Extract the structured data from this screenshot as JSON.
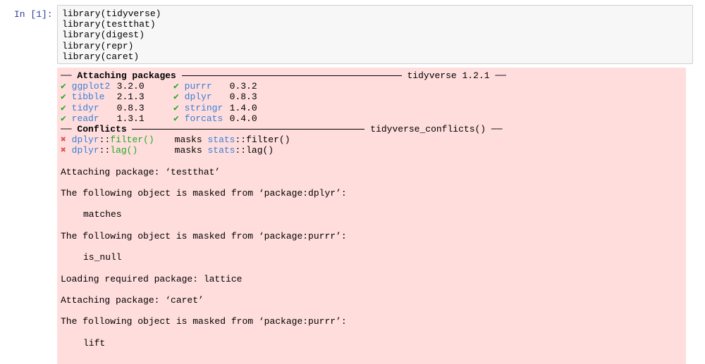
{
  "cell": {
    "prompt": "In [1]:",
    "code_lines": [
      "library(tidyverse)",
      "library(testthat)",
      "library(digest)",
      "library(repr)",
      "library(caret)"
    ]
  },
  "output": {
    "attach_header": {
      "dash": "──",
      "title": "Attaching packages",
      "right": "tidyverse 1.2.1",
      "tail": "──"
    },
    "check_mark": "✔",
    "packages": [
      {
        "name": "ggplot2",
        "version": "3.2.0"
      },
      {
        "name": "purrr",
        "version": "0.3.2"
      },
      {
        "name": "tibble",
        "version": "2.1.3"
      },
      {
        "name": "dplyr",
        "version": "0.8.3"
      },
      {
        "name": "tidyr",
        "version": "0.8.3"
      },
      {
        "name": "stringr",
        "version": "1.4.0"
      },
      {
        "name": "readr",
        "version": "1.3.1"
      },
      {
        "name": "forcats",
        "version": "0.4.0"
      }
    ],
    "conflicts_header": {
      "dash": "──",
      "title": "Conflicts",
      "right": "tidyverse_conflicts()",
      "tail": "──"
    },
    "cross_mark": "✖",
    "conflicts": [
      {
        "pkg": "dplyr",
        "sep": "::",
        "fn": "filter()",
        "masks": "masks",
        "masked_pkg": "stats",
        "masked_fn": "::filter()"
      },
      {
        "pkg": "dplyr",
        "sep": "::",
        "fn": "lag()",
        "masks": "masks",
        "masked_pkg": "stats",
        "masked_fn": "::lag()"
      }
    ],
    "messages": [
      "Attaching package: ‘testthat’",
      "The following object is masked from ‘package:dplyr’:",
      "matches",
      "The following object is masked from ‘package:purrr’:",
      "is_null",
      "Loading required package: lattice",
      "Attaching package: ‘caret’",
      "The following object is masked from ‘package:purrr’:",
      "lift"
    ]
  }
}
